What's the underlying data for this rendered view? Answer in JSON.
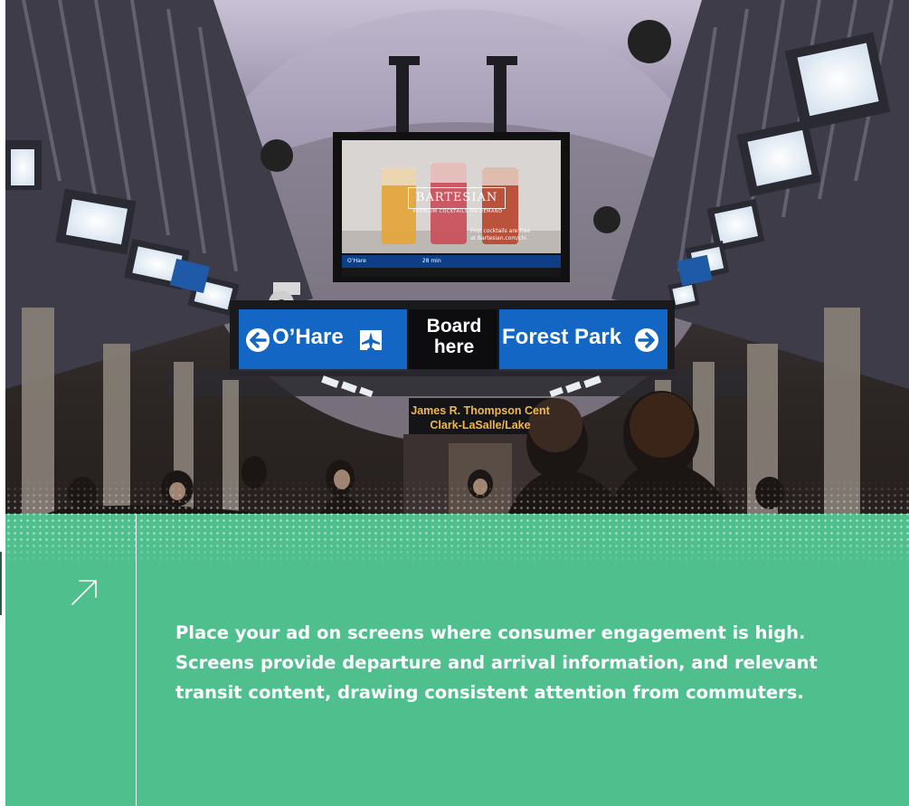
{
  "photo": {
    "sign": {
      "left_destination": "O’Hare",
      "board_line1": "Board",
      "board_line2": "here",
      "right_destination": "Forest Park",
      "left_arrow_icon": "arrow-left-circle-icon",
      "right_arrow_icon": "arrow-right-circle-icon",
      "airport_icon": "airplane-icon",
      "sign_color": "#1466c4"
    },
    "station_sign": {
      "line1": "James R. Thompson Cent",
      "line2": "Clark-LaSalle/Lake"
    },
    "screen": {
      "brand": "BARTESIAN",
      "tagline": "PREMIUM COCKTAILS ON DEMAND",
      "note": "First cocktails are free at Bartesian.com/chi",
      "ticker_left": "O’Hare",
      "ticker_right": "28 min"
    }
  },
  "panel": {
    "arrow_icon": "arrow-up-right-icon",
    "description": "Place your ad on screens where consumer engagement is high. Screens provide departure and arrival information, and relevant transit content, drawing consistent attention from commuters.",
    "color": "#4fbf8e"
  }
}
